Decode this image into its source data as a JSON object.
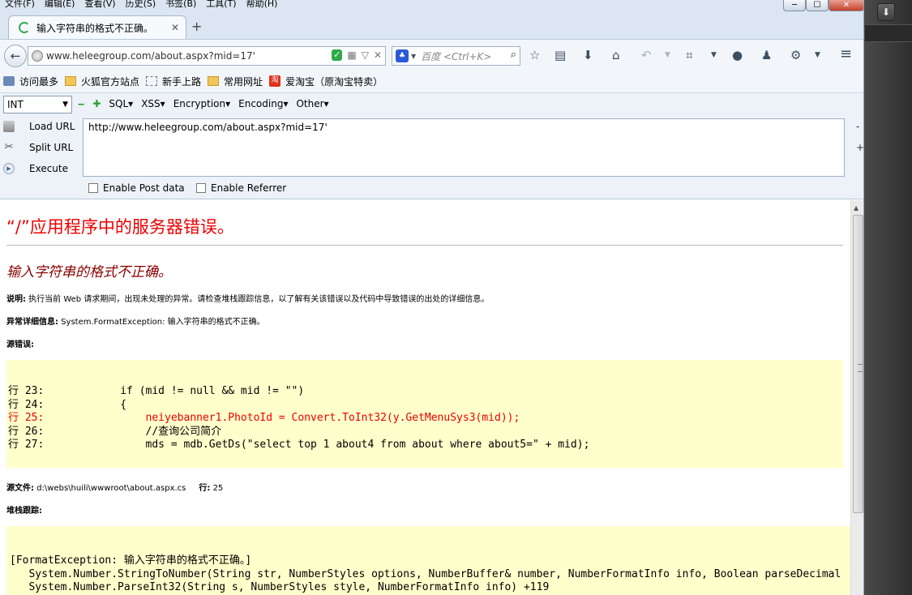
{
  "menubar": {
    "items": [
      "文件(F)",
      "编辑(E)",
      "查看(V)",
      "历史(S)",
      "书签(B)",
      "工具(T)",
      "帮助(H)"
    ]
  },
  "window_controls": {
    "minimize": "─",
    "maximize": "☐",
    "close": "✕"
  },
  "tab": {
    "title": "输入字符串的格式不正确。",
    "close": "✕",
    "new_tab": "+"
  },
  "navbar": {
    "url": "www.heleegroup.com/about.aspx?mid=17'",
    "search_placeholder": "百度 <Ctrl+K>"
  },
  "bookmarks": [
    {
      "label": "访问最多",
      "icon": "key"
    },
    {
      "label": "火狐官方站点",
      "icon": "folder"
    },
    {
      "label": "新手上路",
      "icon": "dash"
    },
    {
      "label": "常用网址",
      "icon": "folder"
    },
    {
      "label": "爱淘宝（原淘宝特卖）",
      "icon": "tao"
    }
  ],
  "hackbar": {
    "select_value": "INT",
    "menus": [
      "SQL▾",
      "XSS▾",
      "Encryption▾",
      "Encoding▾",
      "Other▾"
    ],
    "load_url": "Load URL",
    "split_url": "Split URL",
    "execute": "Execute",
    "url_value": "http://www.heleegroup.com/about.aspx?mid=17'",
    "enable_post": "Enable Post data",
    "enable_referrer": "Enable Referrer",
    "minus": "-",
    "plus": "+"
  },
  "page": {
    "error_title": "“/”应用程序中的服务器错误。",
    "error_message": "输入字符串的格式不正确。",
    "desc_label": "说明:",
    "desc_text": " 执行当前 Web 请求期间，出现未处理的异常。请检查堆栈跟踪信息，以了解有关该错误以及代码中导致错误的出处的详细信息。",
    "exception_label": "异常详细信息:",
    "exception_text": " System.FormatException: 输入字符串的格式不正确。",
    "source_error_label": "源错误:",
    "code_lines": [
      {
        "text": "行 23:            if (mid != null && mid != \"\")",
        "highlight": false
      },
      {
        "text": "行 24:            {",
        "highlight": false
      },
      {
        "text": "行 25:                neiyebanner1.PhotoId = Convert.ToInt32(y.GetMenuSys3(mid));",
        "highlight": true
      },
      {
        "text": "行 26:                //查询公司简介",
        "highlight": false
      },
      {
        "text": "行 27:                mds = mdb.GetDs(\"select top 1 about4 from about where about5=\" + mid);",
        "highlight": false
      }
    ],
    "source_file_label": "源文件:",
    "source_file_value": " d:\\webs\\huili\\wwwroot\\about.aspx.cs",
    "line_label": "行:",
    "line_value": " 25",
    "stack_label": "堆栈跟踪:",
    "stack_lines": [
      "[FormatException: 输入字符串的格式不正确。]",
      "   System.Number.StringToNumber(String str, NumberStyles options, NumberBuffer& number, NumberFormatInfo info, Boolean parseDecimal",
      "   System.Number.ParseInt32(String s, NumberStyles style, NumberFormatInfo info) +119"
    ]
  }
}
